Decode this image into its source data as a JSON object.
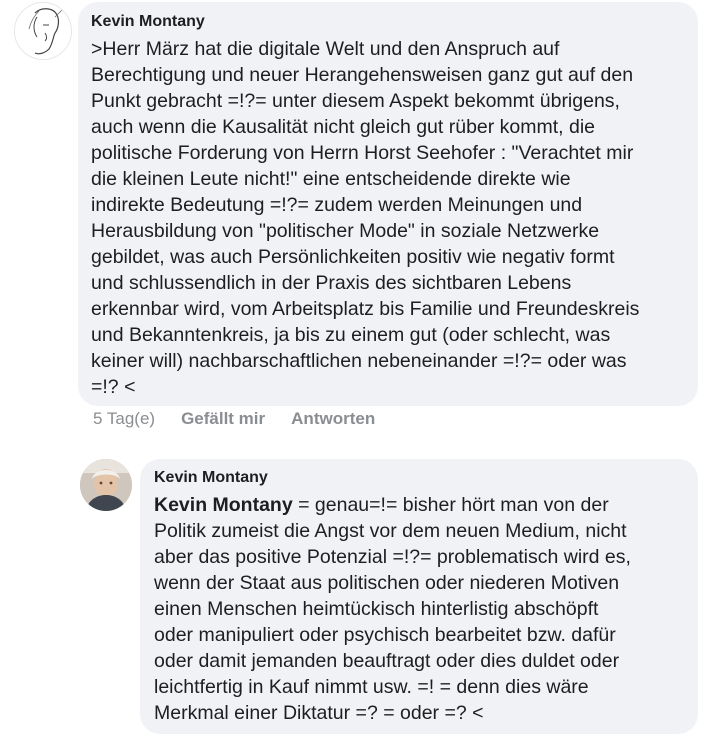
{
  "comment": {
    "author": "Kevin Montany",
    "text": ">Herr März hat die digitale Welt und den Anspruch auf\nBerechtigung und neuer Herangehensweisen ganz gut auf den\nPunkt gebracht =!?= unter diesem Aspekt bekommt übrigens,\nauch wenn die Kausalität nicht gleich gut rüber kommt, die\npolitische Forderung von Herrn Horst Seehofer : \"Verachtet mir\ndie kleinen Leute nicht!\" eine entscheidende direkte wie\nindirekte Bedeutung =!?= zudem werden Meinungen und\nHerausbildung von \"politischer Mode\" in soziale Netzwerke\ngebildet, was auch Persönlichkeiten positiv wie negativ formt\nund schlussendlich in der Praxis des sichtbaren Lebens\nerkennbar wird, vom Arbeitsplatz bis Familie und Freundeskreis\nund Bekanntenkreis, ja bis zu einem gut (oder schlecht, was\nkeiner will) nachbarschaftlichen nebeneinander =!?= oder was\n=!? <",
    "time": "5 Tag(e)",
    "like_label": "Gefällt mir",
    "reply_label": "Antworten"
  },
  "reply": {
    "author": "Kevin Montany",
    "mention": "Kevin Montany",
    "text": " = genau=!= bisher hört man von der\nPolitik zumeist die Angst vor dem neuen Medium, nicht\naber das positive Potenzial =!?= problematisch wird es,\nwenn der Staat aus politischen oder niederen Motiven\neinen Menschen heimtückisch hinterlistig abschöpft\noder manipuliert oder psychisch bearbeitet bzw. dafür\noder damit jemanden  beauftragt oder dies duldet oder\nleichtfertig in Kauf nimmt usw. =! = denn dies wäre\nMerkmal einer Diktatur =? = oder =? <"
  },
  "colors": {
    "bubble": "#f0f2f5",
    "text": "#1c1e21",
    "meta": "#8a8d91"
  }
}
